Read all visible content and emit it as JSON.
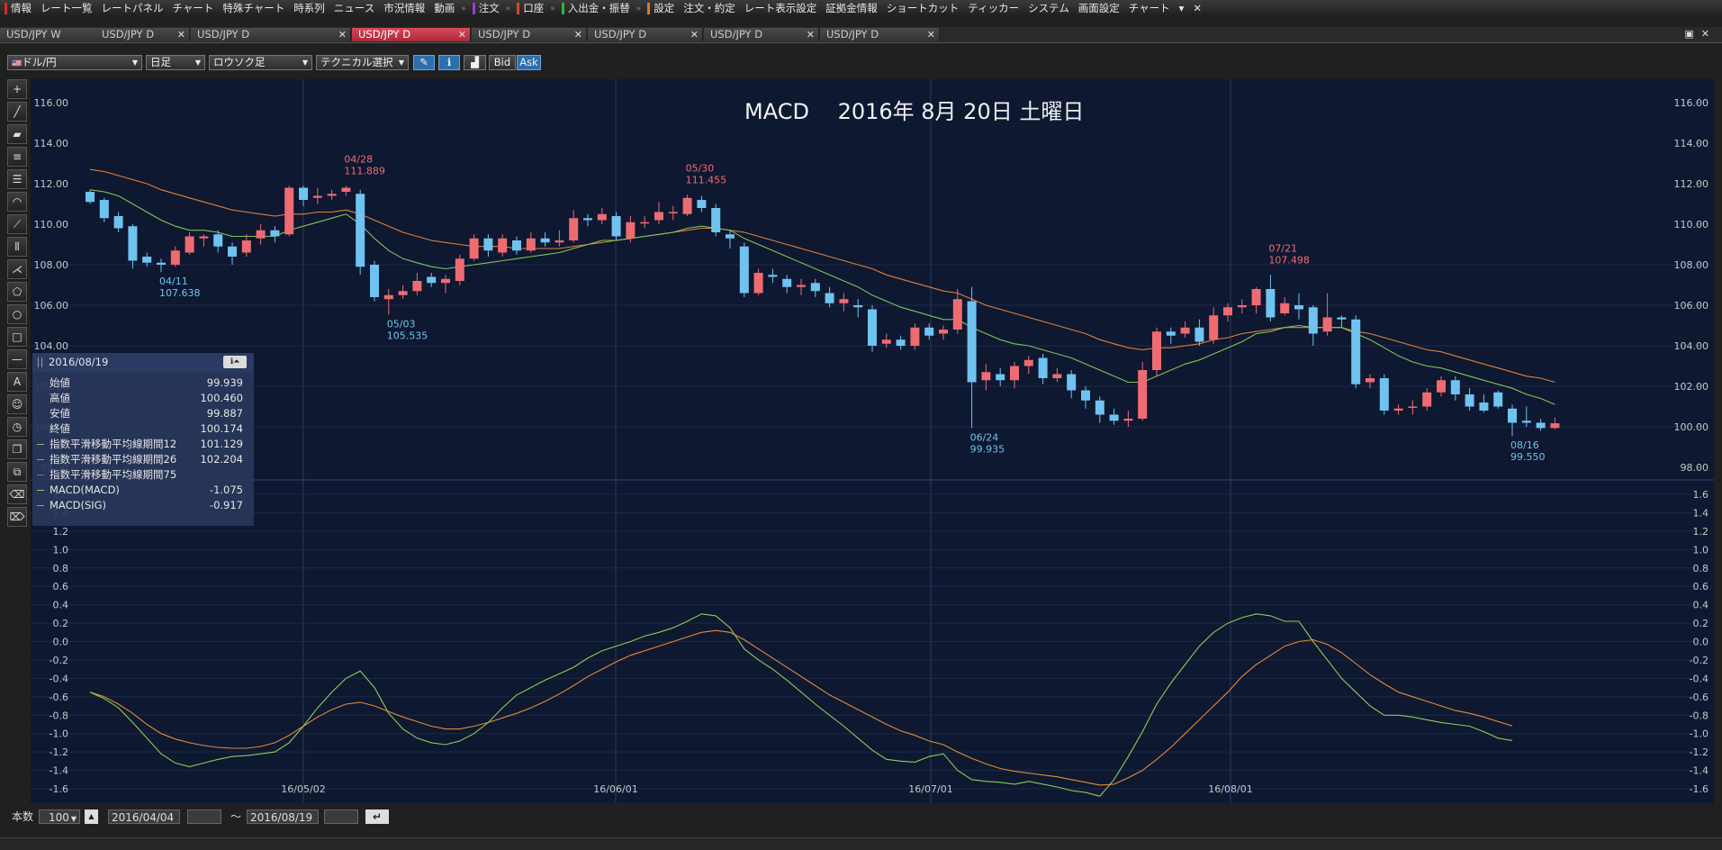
{
  "menu": {
    "items": [
      {
        "label": "情報",
        "mark": "#d42a2a"
      },
      {
        "label": "レート一覧",
        "mark": ""
      },
      {
        "label": "レートパネル",
        "mark": ""
      },
      {
        "label": "チャート",
        "mark": ""
      },
      {
        "label": "特殊チャート",
        "mark": ""
      },
      {
        "label": "時系列",
        "mark": ""
      },
      {
        "label": "ニュース",
        "mark": ""
      },
      {
        "label": "市況情報",
        "mark": ""
      },
      {
        "label": "動画",
        "mark": ""
      },
      {
        "label": "注文",
        "mark": "#9a3bd6"
      },
      {
        "label": "口座",
        "mark": "#d44a2a"
      },
      {
        "label": "入出金・振替",
        "mark": "#2ab44a"
      },
      {
        "label": "設定",
        "mark": "#e07a1a"
      },
      {
        "label": "注文・約定",
        "mark": ""
      },
      {
        "label": "レート表示設定",
        "mark": ""
      },
      {
        "label": "証拠金情報",
        "mark": ""
      },
      {
        "label": "ショートカット",
        "mark": ""
      },
      {
        "label": "ティッカー",
        "mark": ""
      },
      {
        "label": "システム",
        "mark": ""
      },
      {
        "label": "画面設定",
        "mark": ""
      },
      {
        "label": "チャート",
        "mark": ""
      }
    ],
    "overflow_icon": "▾",
    "close_icon": "✕"
  },
  "tabs": [
    {
      "label": "USD/JPY W",
      "active": false
    },
    {
      "label": "USD/JPY D",
      "active": false
    },
    {
      "label": "USD/JPY D",
      "active": false
    },
    {
      "label": "USD/JPY D",
      "active": true
    },
    {
      "label": "USD/JPY D",
      "active": false
    },
    {
      "label": "USD/JPY D",
      "active": false
    },
    {
      "label": "USD/JPY D",
      "active": false
    },
    {
      "label": "USD/JPY D",
      "active": false
    }
  ],
  "toolbar": {
    "currency": "ドル/円",
    "period": "日足",
    "chart_type": "ロウソク足",
    "technical": "テクニカル選択",
    "bid": "Bid",
    "ask": "Ask"
  },
  "chart": {
    "title": "MACD　 2016年 8月 20日 土曜日",
    "price_ticks": [
      "116.00",
      "114.00",
      "112.00",
      "110.00",
      "108.00",
      "106.00",
      "104.00",
      "102.00",
      "100.00",
      "98.00"
    ],
    "macd_ticks": [
      "1.6",
      "1.4",
      "1.2",
      "1.0",
      "0.8",
      "0.6",
      "0.4",
      "0.2",
      "0.0",
      "-0.2",
      "-0.4",
      "-0.6",
      "-0.8",
      "-1.0",
      "-1.2",
      "-1.4",
      "-1.6"
    ],
    "date_labels": [
      "16/05/02",
      "16/06/01",
      "16/07/01",
      "16/08/01"
    ],
    "annotations": [
      {
        "date": "04/11",
        "price": "107.638",
        "color": "#6fc3f0"
      },
      {
        "date": "04/28",
        "price": "111.889",
        "color": "#ee6b72"
      },
      {
        "date": "05/03",
        "price": "105.535",
        "color": "#6fc3f0"
      },
      {
        "date": "05/30",
        "price": "111.455",
        "color": "#ee6b72"
      },
      {
        "date": "06/24",
        "price": "99.935",
        "color": "#6fc3f0"
      },
      {
        "date": "07/21",
        "price": "107.498",
        "color": "#ee6b72"
      },
      {
        "date": "08/16",
        "price": "99.550",
        "color": "#6fc3f0"
      }
    ],
    "colors": {
      "up": "#ee6b72",
      "down": "#6fc3f0",
      "ema_fast": "#7ec45a",
      "ema_slow": "#e0803a",
      "macd": "#8dcc56",
      "signal": "#e08a3a",
      "bg": "#0e1830"
    }
  },
  "info_panel": {
    "date": "2016/08/19",
    "rows": [
      {
        "label": "始値",
        "value": "99.939",
        "color": ""
      },
      {
        "label": "高値",
        "value": "100.460",
        "color": ""
      },
      {
        "label": "安値",
        "value": "99.887",
        "color": ""
      },
      {
        "label": "終値",
        "value": "100.174",
        "color": ""
      },
      {
        "label": "指数平滑移動平均線期間12",
        "value": "101.129",
        "color": "#7ec45a"
      },
      {
        "label": "指数平滑移動平均線期間26",
        "value": "102.204",
        "color": "#e0803a"
      },
      {
        "label": "指数平滑移動平均線期間75",
        "value": "",
        "color": "#5a6ad8"
      },
      {
        "label": "MACD(MACD)",
        "value": "-1.075",
        "color": "#8dcc56"
      },
      {
        "label": "MACD(SIG)",
        "value": "-0.917",
        "color": "#e08a3a"
      }
    ]
  },
  "footer": {
    "count_label": "本数",
    "count": "100",
    "start_date": "2016/04/04",
    "tilde": "〜",
    "end_date": "2016/08/19"
  },
  "chart_data": {
    "type": "candlestick",
    "title": "MACD　 2016年 8月 20日 土曜日",
    "price_range": [
      98.0,
      116.0
    ],
    "macd_range": [
      -1.6,
      1.6
    ],
    "candles": [
      [
        111.6,
        111.1,
        111.7,
        111.0
      ],
      [
        111.2,
        110.3,
        111.3,
        110.1
      ],
      [
        110.4,
        109.8,
        110.6,
        109.6
      ],
      [
        109.9,
        108.2,
        110.0,
        107.8
      ],
      [
        108.4,
        108.1,
        108.6,
        107.9
      ],
      [
        108.1,
        108.0,
        108.3,
        107.64
      ],
      [
        108.0,
        108.7,
        108.9,
        107.9
      ],
      [
        108.6,
        109.4,
        109.6,
        108.5
      ],
      [
        109.3,
        109.4,
        109.5,
        108.9
      ],
      [
        109.5,
        108.9,
        109.7,
        108.6
      ],
      [
        108.9,
        108.4,
        109.1,
        108.0
      ],
      [
        108.6,
        109.2,
        109.5,
        108.4
      ],
      [
        109.3,
        109.7,
        110.0,
        109.0
      ],
      [
        109.7,
        109.4,
        109.9,
        109.1
      ],
      [
        109.5,
        111.8,
        111.9,
        109.4
      ],
      [
        111.8,
        111.2,
        111.9,
        110.9
      ],
      [
        111.3,
        111.4,
        111.8,
        111.0
      ],
      [
        111.4,
        111.5,
        111.7,
        111.2
      ],
      [
        111.6,
        111.8,
        111.889,
        111.4
      ],
      [
        111.5,
        107.9,
        111.7,
        107.5
      ],
      [
        108.0,
        106.4,
        108.2,
        106.2
      ],
      [
        106.3,
        106.5,
        106.8,
        105.535
      ],
      [
        106.5,
        106.7,
        107.0,
        106.3
      ],
      [
        106.7,
        107.2,
        107.6,
        106.5
      ],
      [
        107.4,
        107.1,
        107.6,
        106.9
      ],
      [
        107.1,
        107.3,
        107.5,
        106.6
      ],
      [
        107.2,
        108.3,
        108.5,
        107.0
      ],
      [
        108.3,
        109.3,
        109.5,
        108.2
      ],
      [
        109.3,
        108.7,
        109.5,
        108.4
      ],
      [
        108.6,
        109.3,
        109.5,
        108.4
      ],
      [
        109.2,
        108.7,
        109.4,
        108.5
      ],
      [
        108.7,
        109.3,
        109.6,
        108.6
      ],
      [
        109.3,
        109.1,
        109.6,
        108.9
      ],
      [
        109.1,
        109.2,
        109.7,
        108.9
      ],
      [
        109.2,
        110.3,
        110.7,
        109.1
      ],
      [
        110.3,
        110.2,
        110.5,
        109.9
      ],
      [
        110.2,
        110.5,
        110.8,
        110.0
      ],
      [
        110.4,
        109.4,
        110.6,
        109.2
      ],
      [
        109.3,
        110.1,
        110.4,
        109.1
      ],
      [
        110.1,
        110.1,
        110.4,
        109.8
      ],
      [
        110.2,
        110.6,
        111.1,
        110.0
      ],
      [
        110.6,
        110.6,
        110.9,
        110.2
      ],
      [
        110.5,
        111.3,
        111.455,
        110.4
      ],
      [
        111.2,
        110.8,
        111.4,
        110.6
      ],
      [
        110.8,
        109.6,
        111.0,
        109.4
      ],
      [
        109.5,
        109.3,
        109.7,
        108.8
      ],
      [
        108.9,
        106.6,
        109.1,
        106.4
      ],
      [
        106.6,
        107.6,
        107.8,
        106.5
      ],
      [
        107.5,
        107.4,
        107.8,
        107.1
      ],
      [
        107.3,
        106.9,
        107.5,
        106.6
      ],
      [
        106.9,
        107.0,
        107.3,
        106.5
      ],
      [
        107.1,
        106.7,
        107.3,
        106.4
      ],
      [
        106.6,
        106.1,
        106.9,
        105.9
      ],
      [
        106.1,
        106.3,
        106.6,
        105.7
      ],
      [
        106.0,
        105.9,
        106.3,
        105.4
      ],
      [
        105.8,
        104.0,
        106.0,
        103.7
      ],
      [
        104.1,
        104.3,
        104.6,
        103.9
      ],
      [
        104.3,
        104.0,
        104.5,
        103.8
      ],
      [
        104.0,
        104.9,
        105.1,
        103.8
      ],
      [
        104.9,
        104.5,
        105.1,
        104.3
      ],
      [
        104.6,
        104.8,
        105.0,
        104.3
      ],
      [
        104.8,
        106.3,
        106.8,
        104.6
      ],
      [
        106.2,
        102.2,
        106.9,
        99.935
      ],
      [
        102.3,
        102.7,
        103.1,
        101.8
      ],
      [
        102.6,
        102.3,
        102.9,
        102.0
      ],
      [
        102.3,
        103.0,
        103.2,
        101.9
      ],
      [
        103.0,
        103.3,
        103.5,
        102.6
      ],
      [
        103.4,
        102.4,
        103.6,
        102.1
      ],
      [
        102.4,
        102.6,
        102.9,
        102.2
      ],
      [
        102.6,
        101.8,
        102.8,
        101.4
      ],
      [
        101.8,
        101.3,
        102.0,
        100.9
      ],
      [
        101.3,
        100.6,
        101.5,
        100.2
      ],
      [
        100.6,
        100.3,
        100.9,
        100.1
      ],
      [
        100.3,
        100.4,
        100.8,
        100.0
      ],
      [
        100.4,
        102.8,
        103.2,
        100.3
      ],
      [
        102.8,
        104.7,
        104.9,
        102.5
      ],
      [
        104.7,
        104.5,
        104.9,
        104.1
      ],
      [
        104.6,
        104.9,
        105.2,
        104.4
      ],
      [
        104.9,
        104.2,
        105.3,
        104.0
      ],
      [
        104.3,
        105.5,
        105.9,
        104.1
      ],
      [
        105.5,
        105.9,
        106.1,
        105.2
      ],
      [
        105.9,
        106.0,
        106.3,
        105.6
      ],
      [
        106.0,
        106.8,
        106.9,
        105.6
      ],
      [
        106.8,
        105.4,
        107.498,
        105.2
      ],
      [
        105.6,
        106.1,
        106.4,
        105.5
      ],
      [
        106.0,
        105.8,
        106.6,
        105.3
      ],
      [
        105.9,
        104.6,
        106.0,
        104.0
      ],
      [
        104.7,
        105.4,
        106.6,
        104.5
      ],
      [
        105.4,
        105.3,
        105.5,
        104.9
      ],
      [
        105.3,
        102.1,
        105.5,
        101.9
      ],
      [
        102.2,
        102.4,
        102.6,
        101.9
      ],
      [
        102.4,
        100.8,
        102.6,
        100.6
      ],
      [
        100.8,
        100.9,
        101.1,
        100.6
      ],
      [
        101.0,
        101.0,
        101.3,
        100.6
      ],
      [
        101.0,
        101.7,
        101.9,
        100.8
      ],
      [
        101.7,
        102.3,
        102.5,
        101.5
      ],
      [
        102.3,
        101.6,
        102.5,
        101.3
      ],
      [
        101.6,
        101.0,
        101.9,
        100.8
      ],
      [
        101.2,
        100.8,
        101.6,
        100.7
      ],
      [
        101.7,
        101.0,
        101.8,
        100.9
      ],
      [
        100.9,
        100.2,
        101.1,
        99.55
      ],
      [
        100.3,
        100.2,
        101.0,
        100.0
      ],
      [
        100.2,
        99.94,
        100.4,
        99.8
      ],
      [
        99.939,
        100.174,
        100.46,
        99.887
      ]
    ],
    "ema12": [
      111.7,
      111.6,
      111.4,
      111.0,
      110.6,
      110.2,
      109.9,
      109.7,
      109.7,
      109.6,
      109.4,
      109.4,
      109.4,
      109.4,
      109.7,
      109.9,
      110.1,
      110.3,
      110.5,
      110.0,
      109.3,
      108.7,
      108.3,
      108.1,
      107.9,
      107.8,
      107.9,
      108.0,
      108.1,
      108.2,
      108.3,
      108.4,
      108.5,
      108.6,
      108.8,
      109.0,
      109.2,
      109.2,
      109.3,
      109.4,
      109.5,
      109.6,
      109.8,
      109.9,
      109.8,
      109.7,
      109.3,
      109.0,
      108.7,
      108.4,
      108.1,
      107.8,
      107.5,
      107.2,
      106.9,
      106.5,
      106.2,
      105.9,
      105.7,
      105.5,
      105.3,
      105.3,
      104.9,
      104.6,
      104.3,
      104.1,
      104.0,
      103.8,
      103.6,
      103.4,
      103.1,
      102.8,
      102.5,
      102.2,
      102.2,
      102.5,
      102.8,
      103.1,
      103.3,
      103.6,
      103.9,
      104.2,
      104.6,
      104.7,
      104.9,
      105.0,
      104.9,
      104.9,
      104.9,
      104.6,
      104.3,
      103.9,
      103.5,
      103.2,
      103.0,
      102.9,
      102.7,
      102.5,
      102.3,
      102.1,
      101.9,
      101.6,
      101.4,
      101.1
    ],
    "ema26": [
      112.7,
      112.6,
      112.4,
      112.2,
      112.0,
      111.7,
      111.5,
      111.3,
      111.1,
      110.9,
      110.7,
      110.6,
      110.5,
      110.4,
      110.5,
      110.5,
      110.6,
      110.6,
      110.7,
      110.5,
      110.2,
      109.9,
      109.6,
      109.4,
      109.2,
      109.1,
      109.0,
      108.9,
      108.9,
      108.9,
      108.8,
      108.8,
      108.8,
      108.8,
      108.9,
      109.0,
      109.1,
      109.2,
      109.3,
      109.4,
      109.5,
      109.6,
      109.7,
      109.8,
      109.8,
      109.7,
      109.6,
      109.4,
      109.2,
      109.0,
      108.8,
      108.6,
      108.4,
      108.2,
      108.0,
      107.8,
      107.5,
      107.3,
      107.1,
      106.9,
      106.7,
      106.6,
      106.3,
      106.0,
      105.8,
      105.6,
      105.4,
      105.2,
      105.0,
      104.8,
      104.6,
      104.3,
      104.1,
      103.9,
      103.8,
      103.9,
      103.9,
      104.0,
      104.1,
      104.3,
      104.4,
      104.6,
      104.7,
      104.8,
      104.9,
      104.9,
      104.9,
      104.9,
      104.9,
      104.7,
      104.6,
      104.4,
      104.2,
      104.0,
      103.8,
      103.7,
      103.5,
      103.3,
      103.1,
      102.9,
      102.7,
      102.5,
      102.4,
      102.2
    ],
    "macd": [
      -0.55,
      -0.62,
      -0.72,
      -0.88,
      -1.05,
      -1.22,
      -1.32,
      -1.36,
      -1.32,
      -1.28,
      -1.25,
      -1.24,
      -1.22,
      -1.2,
      -1.1,
      -0.92,
      -0.72,
      -0.55,
      -0.4,
      -0.32,
      -0.5,
      -0.78,
      -0.95,
      -1.05,
      -1.1,
      -1.12,
      -1.08,
      -1.0,
      -0.88,
      -0.72,
      -0.58,
      -0.5,
      -0.42,
      -0.35,
      -0.28,
      -0.18,
      -0.1,
      -0.05,
      0.0,
      0.06,
      0.1,
      0.15,
      0.22,
      0.3,
      0.28,
      0.15,
      -0.08,
      -0.2,
      -0.3,
      -0.42,
      -0.55,
      -0.68,
      -0.8,
      -0.92,
      -1.05,
      -1.18,
      -1.28,
      -1.3,
      -1.31,
      -1.25,
      -1.22,
      -1.4,
      -1.5,
      -1.52,
      -1.53,
      -1.55,
      -1.52,
      -1.55,
      -1.58,
      -1.62,
      -1.64,
      -1.68,
      -1.5,
      -1.25,
      -0.98,
      -0.68,
      -0.45,
      -0.25,
      -0.05,
      0.1,
      0.2,
      0.26,
      0.3,
      0.28,
      0.22,
      0.22,
      0.0,
      -0.2,
      -0.4,
      -0.55,
      -0.7,
      -0.8,
      -0.8,
      -0.82,
      -0.85,
      -0.88,
      -0.9,
      -0.92,
      -0.98,
      -1.05,
      -1.075
    ],
    "signal": [
      -0.55,
      -0.6,
      -0.68,
      -0.78,
      -0.9,
      -1.0,
      -1.06,
      -1.1,
      -1.13,
      -1.15,
      -1.16,
      -1.16,
      -1.14,
      -1.1,
      -1.02,
      -0.92,
      -0.82,
      -0.74,
      -0.68,
      -0.66,
      -0.7,
      -0.76,
      -0.82,
      -0.87,
      -0.92,
      -0.95,
      -0.95,
      -0.92,
      -0.88,
      -0.83,
      -0.78,
      -0.72,
      -0.65,
      -0.57,
      -0.48,
      -0.38,
      -0.3,
      -0.22,
      -0.15,
      -0.1,
      -0.05,
      0.0,
      0.05,
      0.1,
      0.12,
      0.1,
      0.02,
      -0.08,
      -0.18,
      -0.28,
      -0.38,
      -0.48,
      -0.58,
      -0.66,
      -0.74,
      -0.82,
      -0.9,
      -0.97,
      -1.02,
      -1.08,
      -1.12,
      -1.2,
      -1.27,
      -1.33,
      -1.38,
      -1.41,
      -1.43,
      -1.45,
      -1.47,
      -1.5,
      -1.53,
      -1.56,
      -1.55,
      -1.48,
      -1.4,
      -1.28,
      -1.15,
      -1.0,
      -0.85,
      -0.7,
      -0.55,
      -0.38,
      -0.25,
      -0.15,
      -0.05,
      0.0,
      0.02,
      -0.03,
      -0.12,
      -0.24,
      -0.36,
      -0.46,
      -0.55,
      -0.6,
      -0.65,
      -0.7,
      -0.75,
      -0.78,
      -0.82,
      -0.87,
      -0.917
    ]
  }
}
